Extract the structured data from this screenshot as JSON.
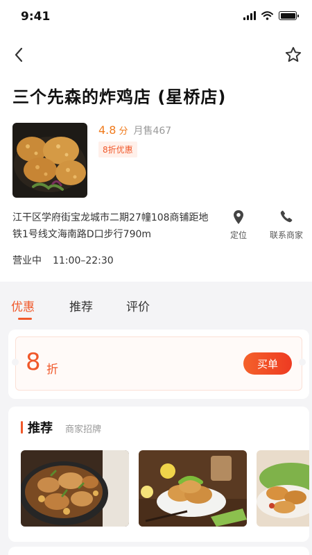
{
  "status_bar": {
    "time": "9:41"
  },
  "store": {
    "name": "三个先森的炸鸡店 (星桥店)",
    "rating": "4.8",
    "rating_unit": "分",
    "monthly_sales": "月售467",
    "discount_tag": "8折优惠",
    "address": "江干区学府街宝龙城市二期27幢108商铺距地铁1号线文海南路D口步行790m",
    "status": "营业中",
    "hours": "11:00–22:30"
  },
  "actions": {
    "locate": "定位",
    "contact": "联系商家"
  },
  "tabs": [
    {
      "label": "优惠",
      "active": true
    },
    {
      "label": "推荐",
      "active": false
    },
    {
      "label": "评价",
      "active": false
    }
  ],
  "deal": {
    "value": "8",
    "unit": "折",
    "buy_label": "买单"
  },
  "recommend": {
    "title": "推荐",
    "subtitle": "商家招牌"
  },
  "icons": {
    "back": "chevron-left-icon",
    "favorite": "star-outline-icon",
    "locate": "map-pin-icon",
    "contact": "phone-icon"
  },
  "colors": {
    "accent": "#f0582a",
    "rating": "#f07b1d",
    "page_bg": "#f4f4f6"
  }
}
